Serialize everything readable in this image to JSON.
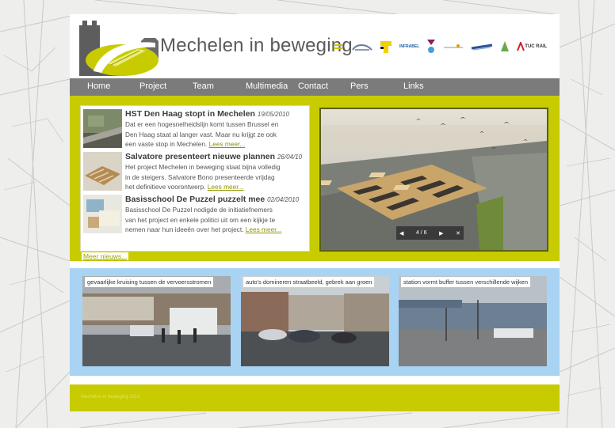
{
  "header": {
    "site_title": "Mechelen in beweging"
  },
  "partners": {
    "infrabel_text": "INFRABEL",
    "tucrail_text": "TUC RAIL"
  },
  "nav": {
    "items": [
      "Home",
      "Project",
      "Team",
      "Multimedia",
      "Contact",
      "Pers",
      "Links"
    ]
  },
  "news": {
    "items": [
      {
        "title": "HST Den Haag stopt in Mechelen",
        "date": "19/05/2010",
        "lines": [
          "Dat er een hogesnelheidslijn komt tussen Brussel en",
          "Den Haag staat al langer vast. Maar nu krijgt ze ook",
          "een vaste stop in Mechelen."
        ],
        "more": "Lees meer..."
      },
      {
        "title": "Salvatore presenteert nieuwe plannen",
        "date": "26/04/10",
        "lines": [
          "Het project Mechelen in beweging staat bijna volledig",
          "in de steigers. Salvatore Bono presenteerde vrijdag",
          "het definitieve voorontwerp."
        ],
        "more": "Lees meer..."
      },
      {
        "title": "Basisschool De Puzzel puzzelt mee",
        "date": "02/04/2010",
        "lines": [
          "Basisschool De Puzzel nodigde de initiatiefnemers",
          "van het project en enkele politici uit om een kijkje te",
          "nemen naar hun ideeën over het project."
        ],
        "more": "Lees meer..."
      }
    ],
    "more_news": "Meer nieuws..."
  },
  "slideshow": {
    "counter": "4 / 6"
  },
  "photos": [
    {
      "caption": "gevaarlijke kruising tussen de vervoersstromen"
    },
    {
      "caption": "auto's domineren straatbeeld, gebrek aan groen"
    },
    {
      "caption": "station vormt buffer tussen verschillende wijken"
    }
  ],
  "footer": {
    "text": "Mechelen in beweging 2010"
  },
  "colors": {
    "accent": "#c7cb00",
    "nav": "#7b7b7b",
    "photo_band": "#a9d3f3"
  }
}
